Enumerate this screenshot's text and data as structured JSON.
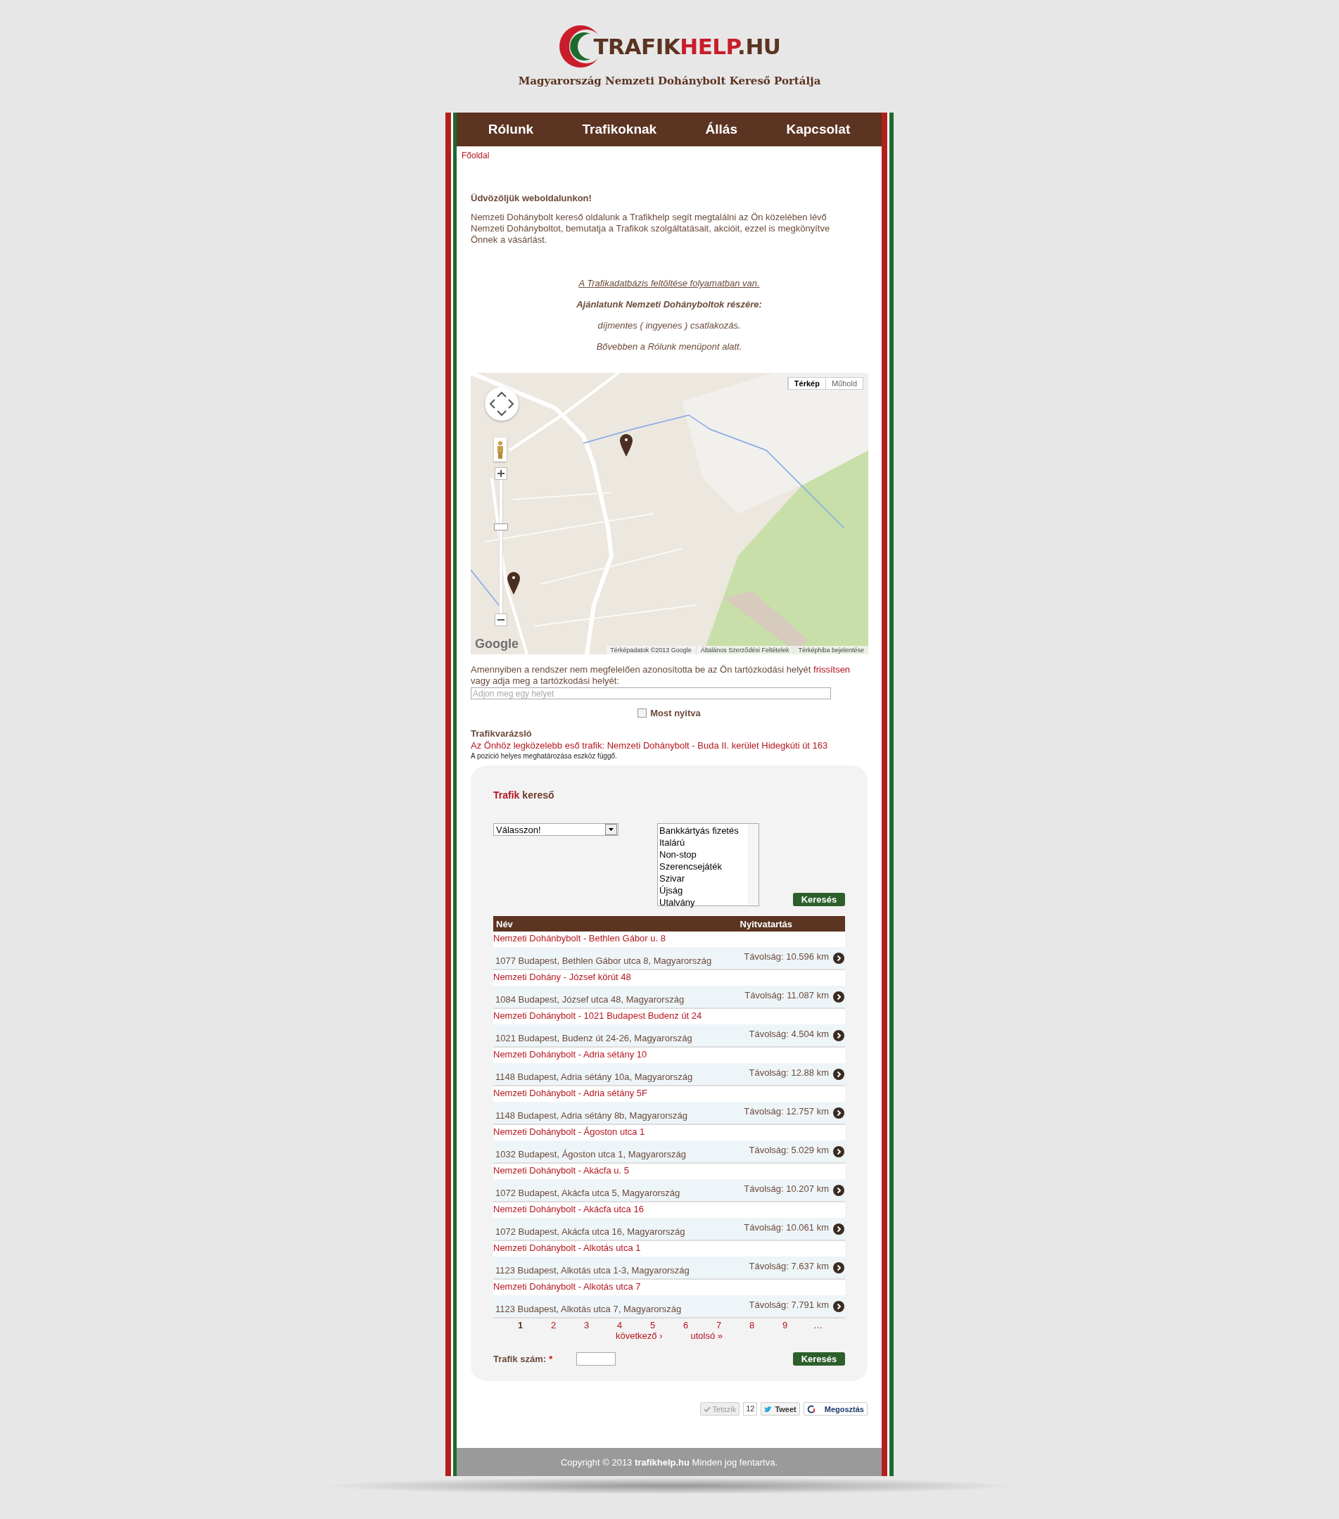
{
  "logo": {
    "parts": [
      {
        "text": "TRAFIK",
        "color": "#5b3421"
      },
      {
        "text": "HELP",
        "color": "#c91d2b"
      },
      {
        "text": ".HU",
        "color": "#5b3421"
      }
    ]
  },
  "tagline": "Magyarország Nemzeti Dohánybolt Kereső Portálja",
  "nav": [
    "Rólunk",
    "Trafikoknak",
    "Állás",
    "Kapcsolat"
  ],
  "breadcrumb": "Főoldal",
  "welcome": {
    "title": "Üdvözöljük weboldalunkon!",
    "body": "Nemzeti Dohánybolt kereső oldalunk a Trafikhelp segít megtalálni az Ön közelében lévő Nemzeti Dohányboltot, bemutatja a Trafikok szolgáltatásait, akcióit, ezzel is megkönyítve Önnek a vásárlást."
  },
  "notices": [
    {
      "kind": "link",
      "text": "A Trafikadatbázis feltöltése folyamatban van."
    },
    {
      "kind": "bold",
      "text": "Ajánlatunk Nemzeti Dohányboltok részére:"
    },
    {
      "kind": "italic",
      "text": "díjmentes ( ingyenes ) csatlakozás."
    },
    {
      "kind": "italic",
      "text": "Bővebben a Rólunk menüpont alatt."
    }
  ],
  "map": {
    "types": [
      {
        "label": "Térkép",
        "selected": true
      },
      {
        "label": "Műhold",
        "selected": false
      }
    ],
    "zoom": {
      "level": 0.65
    },
    "provider": "Google",
    "attribution": [
      "Térképadatok ©2013 Google",
      "Általános Szerződési Feltételek",
      "Térképhiba bejelentése"
    ]
  },
  "location": {
    "prompt": "Amennyiben a rendszer nem megfelelően azonosította be az Ön tartózkodási helyét",
    "link": "frissítsen",
    "prompt_end": "vagy adja meg a tartózkodási helyét:",
    "placeholder": "Adjon meg egy helyet"
  },
  "open_now": {
    "label": "Most nyitva",
    "checked": false
  },
  "wizard": {
    "title": "Trafikvarázsló",
    "nearest": "Az Önhöz legközelebb eső trafik: Nemzeti Dohánybolt - Buda II. kerület Hidegkúti út 163",
    "note": "A pozició helyes meghatározása eszköz függő."
  },
  "search": {
    "title_accent": "Trafik",
    "title": "kereső",
    "select": "Válasszon!",
    "services": [
      {
        "label": "Bankkártyás fizetés",
        "selected": false
      },
      {
        "label": "Italárú",
        "selected": false
      },
      {
        "label": "Non-stop",
        "selected": false
      },
      {
        "label": "Szerencsejáték",
        "selected": false
      },
      {
        "label": "Szivar",
        "selected": false
      },
      {
        "label": "Újság",
        "selected": false
      },
      {
        "label": "Utalvány",
        "selected": false
      }
    ],
    "button": "Keresés"
  },
  "table": {
    "columns": [
      "Név",
      "Nyitvatartás"
    ],
    "rows": [
      {
        "name": "Nemzeti Dohánbybolt - Bethlen Gábor u. 8",
        "address": "1077 Budapest, Bethlen Gábor utca 8, Magyarország",
        "distance": "Távolság: 10.596 km"
      },
      {
        "name": "Nemzeti Dohány - József körút 48",
        "address": "1084 Budapest, József utca 48, Magyarország",
        "distance": "Távolság: 11.087 km"
      },
      {
        "name": "Nemzeti Dohánybolt - 1021 Budapest Budenz út 24",
        "address": "1021 Budapest, Budenz út 24-26, Magyarország",
        "distance": "Távolság: 4.504 km"
      },
      {
        "name": "Nemzeti Dohánybolt - Adria sétány 10",
        "address": "1148 Budapest, Adria sétány 10a, Magyarország",
        "distance": "Távolság: 12.88 km"
      },
      {
        "name": "Nemzeti Dohánybolt - Adria sétány 5F",
        "address": "1148 Budapest, Adria sétány 8b, Magyarország",
        "distance": "Távolság: 12.757 km"
      },
      {
        "name": "Nemzeti Dohánybolt - Ágoston utca 1",
        "address": "1032 Budapest, Ágoston utca 1, Magyarország",
        "distance": "Távolság: 5.029 km"
      },
      {
        "name": "Nemzeti Dohánybolt - Akácfa u. 5",
        "address": "1072 Budapest, Akácfa utca 5, Magyarország",
        "distance": "Távolság: 10.207 km"
      },
      {
        "name": "Nemzeti Dohánybolt - Akácfa utca 16",
        "address": "1072 Budapest, Akácfa utca 16, Magyarország",
        "distance": "Távolság: 10.061 km"
      },
      {
        "name": "Nemzeti Dohánybolt - Alkotás utca 1",
        "address": "1123 Budapest, Alkotás utca 1-3, Magyarország",
        "distance": "Távolság: 7.637 km"
      },
      {
        "name": "Nemzeti Dohánybolt - Alkotás utca 7",
        "address": "1123 Budapest, Alkotás utca 7, Magyarország",
        "distance": "Távolság: 7.791 km"
      }
    ]
  },
  "pagination": {
    "pages": [
      {
        "label": "1",
        "selected": true
      },
      {
        "label": "2",
        "selected": false
      },
      {
        "label": "3",
        "selected": false
      },
      {
        "label": "4",
        "selected": false
      },
      {
        "label": "5",
        "selected": false
      },
      {
        "label": "6",
        "selected": false
      },
      {
        "label": "7",
        "selected": false
      },
      {
        "label": "8",
        "selected": false
      },
      {
        "label": "9",
        "selected": false
      },
      {
        "label": "…",
        "selected": false
      }
    ],
    "next": "következő ›",
    "last": "utolsó »"
  },
  "number_search": {
    "label": "Trafik szám:",
    "required": "*",
    "button": "Keresés"
  },
  "social": {
    "like": "Tetszik",
    "count": "12",
    "tweet": "Tweet",
    "share": "Megosztás"
  },
  "footer": "Copyright © 2013 **trafikhelp.hu** Minden jog fentartva."
}
